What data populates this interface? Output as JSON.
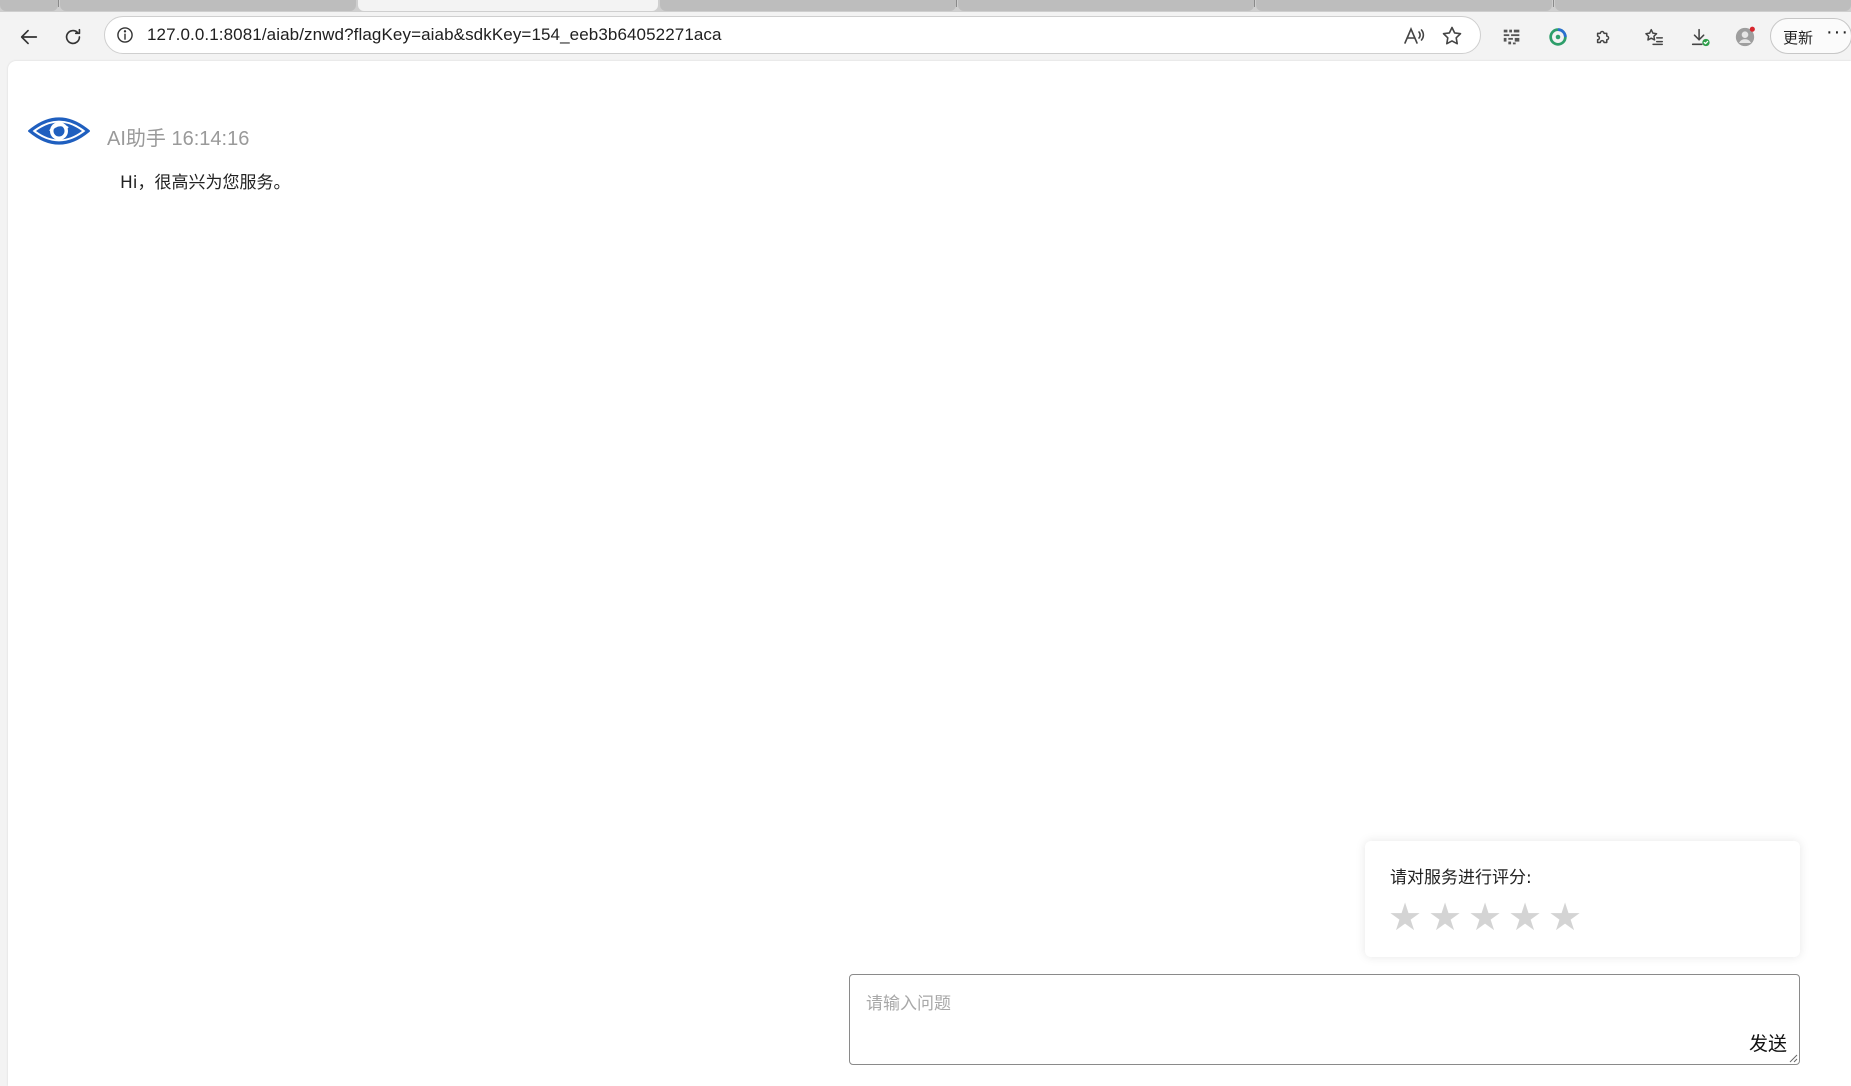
{
  "browser": {
    "url": "127.0.0.1:8081/aiab/znwd?flagKey=aiab&sdkKey=154_eeb3b64052271aca",
    "update_label": "更新",
    "more_label": "···"
  },
  "chat": {
    "messages": [
      {
        "sender": "AI助手",
        "time": "16:14:16",
        "text": "Hi，很高兴为您服务。"
      }
    ]
  },
  "rating": {
    "title": "请对服务进行评分:",
    "max_stars": 5,
    "selected": 0,
    "star_glyph": "★"
  },
  "composer": {
    "placeholder": "请输入问题",
    "send_label": "发送"
  },
  "colors": {
    "brand_blue": "#1f5fbf",
    "star_inactive": "#d4d4d4"
  }
}
